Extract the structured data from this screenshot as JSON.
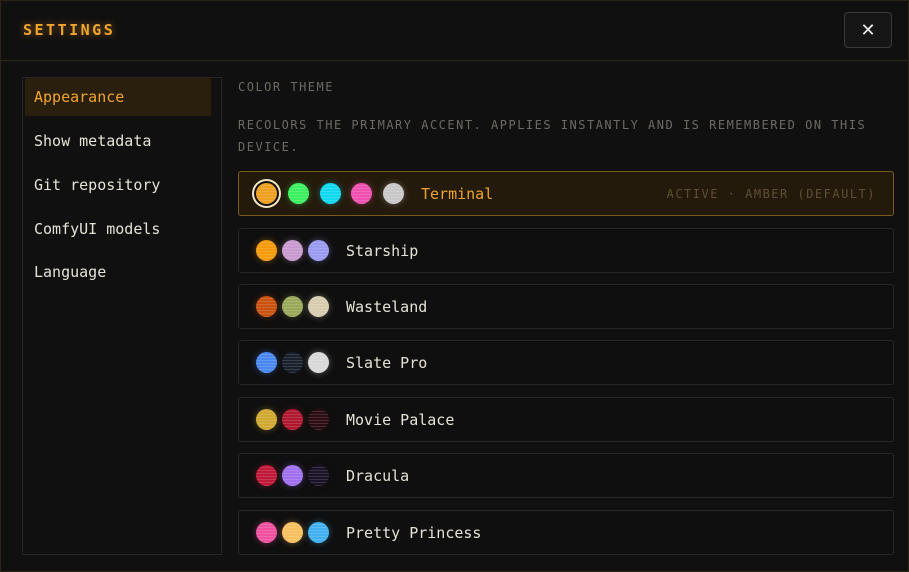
{
  "dialog": {
    "title": "SETTINGS",
    "close_label": "✕"
  },
  "sidebar": {
    "items": [
      {
        "label": "Appearance",
        "active": true
      },
      {
        "label": "Show metadata",
        "active": false
      },
      {
        "label": "Git repository",
        "active": false
      },
      {
        "label": "ComfyUI models",
        "active": false
      },
      {
        "label": "Language",
        "active": false
      }
    ]
  },
  "appearance": {
    "section_label": "COLOR THEME",
    "description": "RECOLORS THE PRIMARY ACCENT. APPLIES INSTANTLY AND IS REMEMBERED ON THIS DEVICE.",
    "themes": [
      {
        "name": "Terminal",
        "active": true,
        "note": "ACTIVE · AMBER (DEFAULT)",
        "swatches": [
          "#f0a020",
          "#3df060",
          "#10d8f0",
          "#f050b0",
          "#c8c8c8"
        ],
        "selected_swatch": 0
      },
      {
        "name": "Starship",
        "active": false,
        "note": "",
        "swatches": [
          "#f59a0a",
          "#c89ad0",
          "#9a9af0"
        ]
      },
      {
        "name": "Wasteland",
        "active": false,
        "note": "",
        "swatches": [
          "#c8520e",
          "#9aa85a",
          "#d8ccb0"
        ]
      },
      {
        "name": "Slate Pro",
        "active": false,
        "note": "",
        "swatches": [
          "#4a88f0",
          "#18202c",
          "#d8d8d8"
        ]
      },
      {
        "name": "Movie Palace",
        "active": false,
        "note": "",
        "swatches": [
          "#d0a830",
          "#b01830",
          "#2a0c12"
        ]
      },
      {
        "name": "Dracula",
        "active": false,
        "note": "",
        "swatches": [
          "#c01838",
          "#a070f0",
          "#1a1226"
        ]
      },
      {
        "name": "Pretty Princess",
        "active": false,
        "note": "",
        "swatches": [
          "#f050a0",
          "#f8c060",
          "#40b0f0"
        ]
      }
    ]
  },
  "colors": {
    "accent": "#f0a52c",
    "background": "#101010"
  }
}
